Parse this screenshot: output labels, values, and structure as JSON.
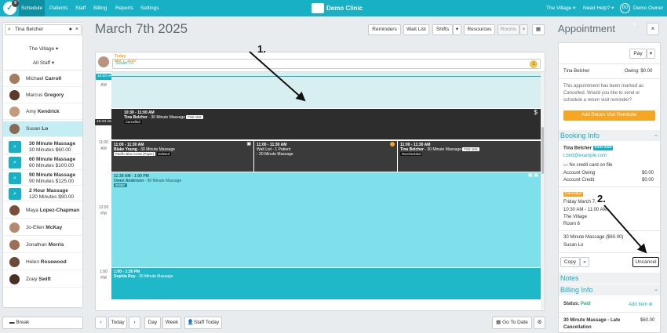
{
  "nav": {
    "logo_badge": "9",
    "items": [
      "Schedule",
      "Patients",
      "Staff",
      "Billing",
      "Reports",
      "Settings"
    ],
    "brand": "Demo Clinic",
    "location": "The Village ▾",
    "help": "Need Help? ▾",
    "user_initials": "DO",
    "user": "Demo Owner ▾"
  },
  "sidebar": {
    "search_value": "Tina Belcher",
    "location_dd": "The Village ▾",
    "staff_dd": "All Staff ▾",
    "staff": [
      {
        "first": "Michael ",
        "last": "Carroll"
      },
      {
        "first": "Marcus ",
        "last": "Gregory"
      },
      {
        "first": "Amy ",
        "last": "Kendrick"
      },
      {
        "first": "Susan ",
        "last": "Lo"
      }
    ],
    "services": [
      {
        "name": "30 Minute Massage",
        "detail": "30 Minutes $60.00"
      },
      {
        "name": "60 Minute Massage",
        "detail": "60 Minutes $100.00"
      },
      {
        "name": "90 Minute Massage",
        "detail": "90 Minutes $125.00"
      },
      {
        "name": "2 Hour Massage",
        "detail": "120 Minutes $90.00"
      }
    ],
    "staff2": [
      {
        "first": "Maya ",
        "last": "Lopez-Chapman"
      },
      {
        "first": "Jo-Ellen ",
        "last": "McKay"
      },
      {
        "first": "Jonathan ",
        "last": "Morris"
      },
      {
        "first": "Helen ",
        "last": "Rosewood"
      },
      {
        "first": "Zoey ",
        "last": "Swift"
      }
    ],
    "break_label": "Break"
  },
  "main": {
    "date_title": "March 7th 2025",
    "toolbar": {
      "reminders": "Reminders",
      "waitlist": "Wait List",
      "shifts": "Shifts",
      "resources": "Resources",
      "rooms": "Rooms"
    },
    "header": {
      "today": "Today",
      "date": "Mar 7, 2026",
      "staff_name": "Susan Lo",
      "count": "1"
    },
    "times": {
      "now": "10:00 AM",
      "am": "AM",
      "t1043": "10:43 AM",
      "t11": "11:00",
      "t12": "12:00",
      "pm": "PM",
      "t1": "1:00",
      "pm2": "PM"
    },
    "appointments": {
      "a1_time": "10:30 - 11:00 AM",
      "a1_name": "Tina Belcher",
      "a1_svc": " - 30 Minute Massage",
      "a1_tag": "First Visit",
      "a1_status": "Cancelled",
      "a1_icon": "$",
      "b1_time": "11:00 - 11:30 AM",
      "b1_name": "Blake Young",
      "b1_svc": " - 30 Minute Massage",
      "b1_ins": "Pacific Blue Cross (Paper)",
      "b1_status": "Deleted",
      "b2_time": "11:00 - 11:30 AM",
      "b2_l1": "Wait List - 1 Patient",
      "b2_l2": "- 30 Minute Massage",
      "b3_time": "11:00 - 11:30 AM",
      "b3_name": "Tina Belcher",
      "b3_svc": " - 30 Minute Massage",
      "b3_tag": "First Visit",
      "b3_status": "Rescheduled",
      "c1_time": "11:30 AM - 1:00 PM",
      "c1_name": "Owen Anderson",
      "c1_svc": " - 90 Minute Massage",
      "c1_tag": "WSBC",
      "d1_time": "1:00 - 1:30 PM",
      "d1_name": "Sophia Roy",
      "d1_svc": " - 30 Minute Massage"
    },
    "bottom": {
      "today": "Today",
      "day": "Day",
      "week": "Week",
      "staff_today": "Staff Today",
      "go_to_date": "Go To Date"
    }
  },
  "panel": {
    "title": "Appointment",
    "close": "×",
    "pay": "Pay",
    "patient": "Tina Belcher",
    "owing_line": "Owing: $0.00",
    "msg1": "This appointment has been marked as",
    "msg2": "Cancelled. Would you like to send or",
    "msg3": "schedule a return visit reminder?",
    "add_reminder": "Add Return Visit Reminder",
    "booking_info": "Booking Info",
    "b_name": "Tina Belcher",
    "b_tag": "First Visit",
    "b_email": "t.bird@example.com",
    "b_card": "No credit card on file",
    "acct_owing_label": "Account Owing",
    "acct_owing_val": "$0.00",
    "acct_credit_label": "Account Credit",
    "acct_credit_val": "$0.00",
    "status_badge": "Cancelled",
    "day": "Friday March 7,",
    "time": "10:30 AM - 11:00 AM",
    "loc": "The Village",
    "room": "Room 6",
    "svc": "30 Minute Massage ($60.00)",
    "prac": "Susan Lo",
    "copy": "Copy",
    "more": "»",
    "uncancel": "Uncancel",
    "notes": "Notes",
    "billing_info": "Billing Info",
    "status_label": "Status: ",
    "status_val": "Paid",
    "add_item": "Add Item ⊕",
    "item1": "30 Minute Massage - Late",
    "item2": "Cancellation",
    "item_price": "$60.00"
  },
  "annotations": {
    "one": "1.",
    "two": "2."
  },
  "colors": {
    "brand": "#18b0c4",
    "accent": "#f5a623",
    "dark_appt": "#3a3a3a"
  }
}
